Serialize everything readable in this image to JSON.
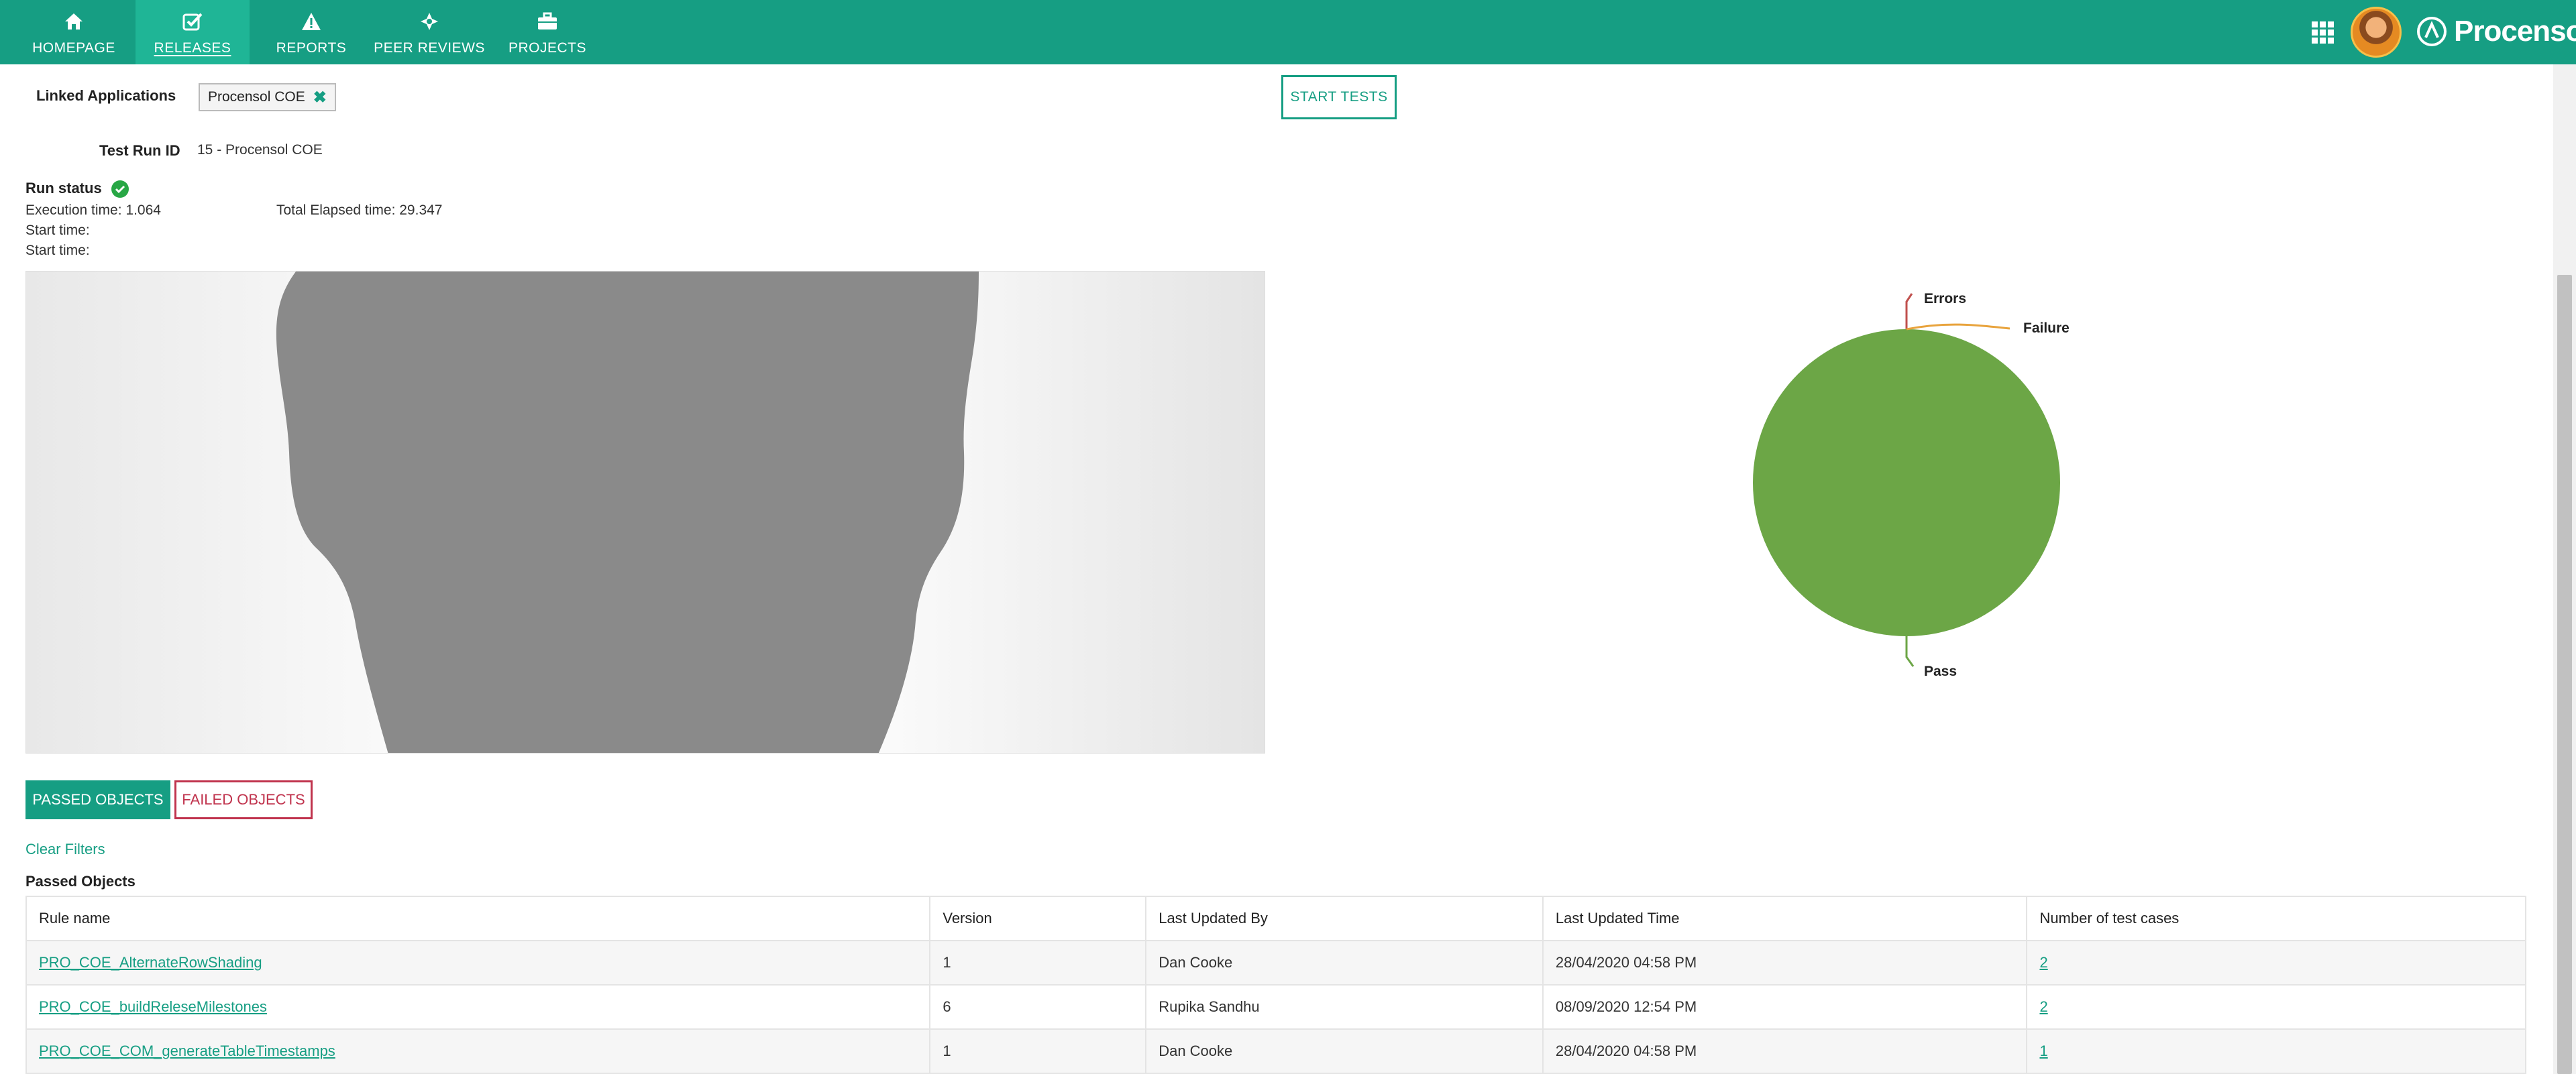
{
  "nav": {
    "items": [
      {
        "label": "HOMEPAGE",
        "icon": "home-icon"
      },
      {
        "label": "RELEASES",
        "icon": "checkbox-icon"
      },
      {
        "label": "REPORTS",
        "icon": "warning-icon"
      },
      {
        "label": "PEER REVIEWS",
        "icon": "crosshair-icon"
      },
      {
        "label": "PROJECTS",
        "icon": "briefcase-icon"
      }
    ],
    "active": "RELEASES",
    "brand": "Procensol"
  },
  "linked": {
    "label": "Linked Applications",
    "chip": "Procensol COE"
  },
  "start_tests": "START TESTS",
  "test_run": {
    "label": "Test Run ID",
    "value": "15 - Procensol COE"
  },
  "run_status": {
    "label": "Run status",
    "execution": "Execution time: 1.064",
    "elapsed": "Total Elapsed time: 29.347",
    "start1": "Start time:",
    "start2": "Start time:"
  },
  "chart_data": {
    "type": "pie",
    "labels": [
      "Errors",
      "Failure",
      "Pass"
    ],
    "values": [
      0,
      0,
      100
    ],
    "colors": [
      "#c0504d",
      "#e8a33c",
      "#6ca646"
    ]
  },
  "tabs": {
    "passed": "PASSED OBJECTS",
    "failed": "FAILED OBJECTS"
  },
  "clear_filters": "Clear Filters",
  "section_title": "Passed Objects",
  "table": {
    "headers": [
      "Rule name",
      "Version",
      "Last Updated By",
      "Last Updated Time",
      "Number of test cases"
    ],
    "rows": [
      {
        "rule": "PRO_COE_AlternateRowShading",
        "version": "1",
        "by": "Dan Cooke",
        "time": "28/04/2020 04:58 PM",
        "count": "2"
      },
      {
        "rule": "PRO_COE_buildReleseMilestones",
        "version": "6",
        "by": "Rupika Sandhu",
        "time": "08/09/2020 12:54 PM",
        "count": "2"
      },
      {
        "rule": "PRO_COE_COM_generateTableTimestamps",
        "version": "1",
        "by": "Dan Cooke",
        "time": "28/04/2020 04:58 PM",
        "count": "1"
      }
    ]
  },
  "colors": {
    "brand": "#169e83",
    "failed": "#c0334d",
    "pass": "#6ca646"
  }
}
